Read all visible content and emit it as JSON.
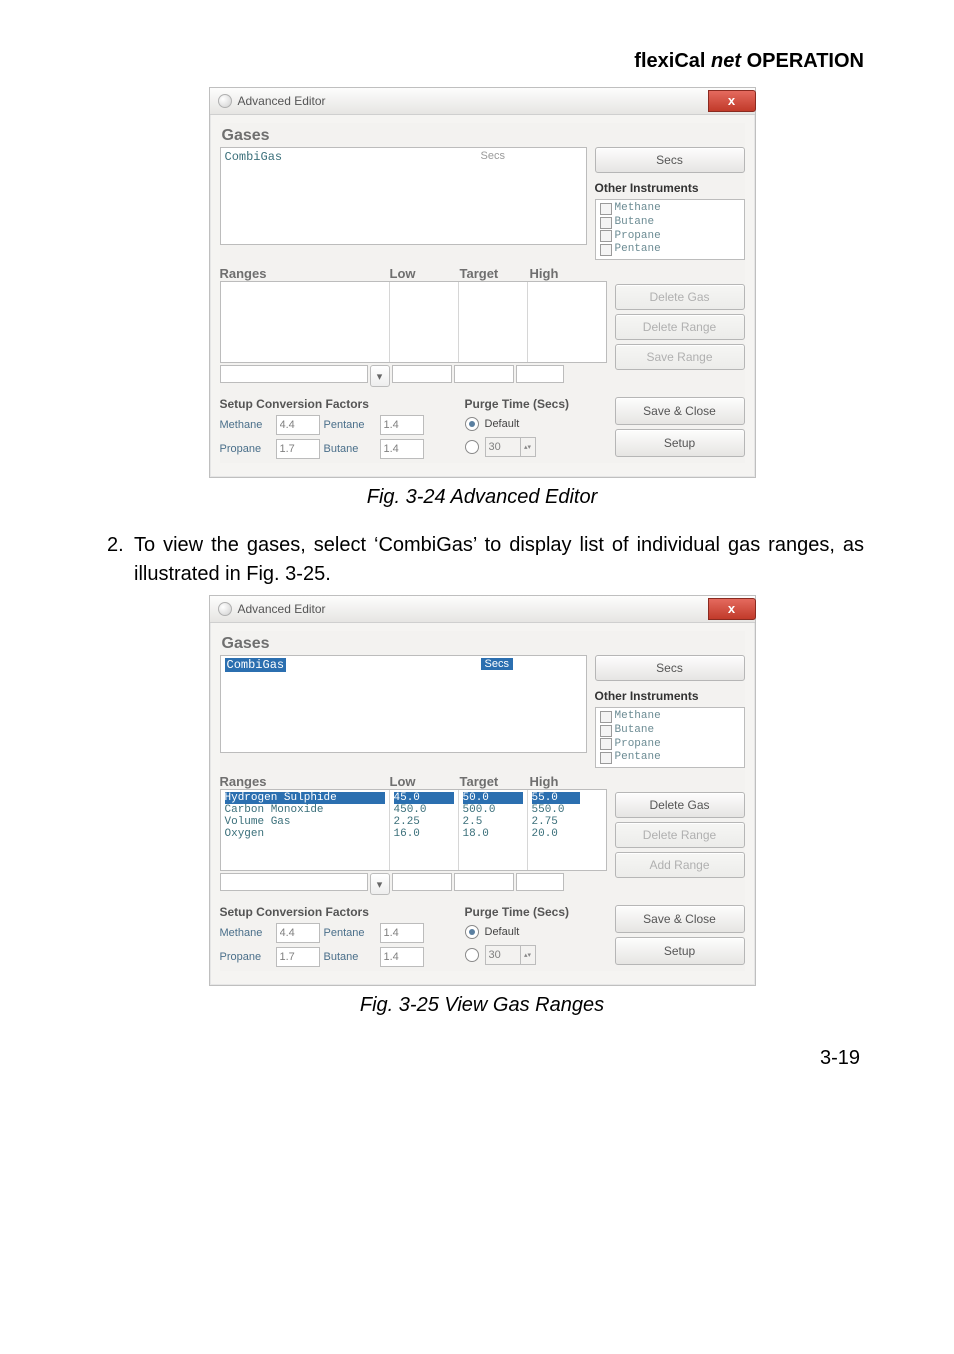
{
  "header": {
    "brand": "flexiCal",
    "ital": "net",
    "rest": "OPERATION"
  },
  "fig24": {
    "title": "Advanced Editor",
    "close_glyph": "x",
    "gases_label": "Gases",
    "gas_list": {
      "name": "CombiGas",
      "secs_header": "Secs"
    },
    "secs_btn": "Secs",
    "other_label": "Other Instruments",
    "other_items": [
      "Methane",
      "Butane",
      "Propane",
      "Pentane"
    ],
    "ranges_label": "Ranges",
    "range_headers": {
      "low": "Low",
      "target": "Target",
      "high": "High"
    },
    "range_rows": [],
    "buttons": {
      "del_gas": "Delete Gas",
      "del_range": "Delete Range",
      "save_range": "Save Range"
    },
    "scf_label": "Setup Conversion Factors",
    "scf": [
      {
        "name": "Methane",
        "val": "4.4",
        "name2": "Pentane",
        "val2": "1.4"
      },
      {
        "name": "Propane",
        "val": "1.7",
        "name2": "Butane",
        "val2": "1.4"
      }
    ],
    "purge_label": "Purge Time (Secs)",
    "purge_default": "Default",
    "purge_custom_val": "30",
    "save_close": "Save & Close",
    "setup": "Setup",
    "caption": "Fig. 3-24  Advanced Editor"
  },
  "step2": {
    "num": "2.",
    "text": "To view the gases, select ‘CombiGas’ to display list of individual gas ranges, as illustrated in Fig. 3-25."
  },
  "fig25": {
    "title": "Advanced Editor",
    "close_glyph": "x",
    "gases_label": "Gases",
    "gas_list": {
      "name": "CombiGas",
      "secs_header": "Secs"
    },
    "secs_btn": "Secs",
    "other_label": "Other Instruments",
    "other_items": [
      "Methane",
      "Butane",
      "Propane",
      "Pentane"
    ],
    "ranges_label": "Ranges",
    "range_headers": {
      "low": "Low",
      "target": "Target",
      "high": "High"
    },
    "range_rows": [
      {
        "name": "Hydrogen Sulphide",
        "low": "45.0",
        "target": "50.0",
        "high": "55.0",
        "hi": true
      },
      {
        "name": "Carbon Monoxide",
        "low": "450.0",
        "target": "500.0",
        "high": "550.0"
      },
      {
        "name": "Volume Gas",
        "low": "2.25",
        "target": "2.5",
        "high": "2.75"
      },
      {
        "name": "Oxygen",
        "low": "16.0",
        "target": "18.0",
        "high": "20.0"
      }
    ],
    "buttons": {
      "del_gas": "Delete Gas",
      "del_range": "Delete Range",
      "add_range": "Add Range"
    },
    "scf_label": "Setup Conversion Factors",
    "scf": [
      {
        "name": "Methane",
        "val": "4.4",
        "name2": "Pentane",
        "val2": "1.4"
      },
      {
        "name": "Propane",
        "val": "1.7",
        "name2": "Butane",
        "val2": "1.4"
      }
    ],
    "purge_label": "Purge Time (Secs)",
    "purge_default": "Default",
    "purge_custom_val": "30",
    "save_close": "Save & Close",
    "setup": "Setup",
    "caption": "Fig. 3-25  View Gas Ranges"
  },
  "footer": "3-19"
}
